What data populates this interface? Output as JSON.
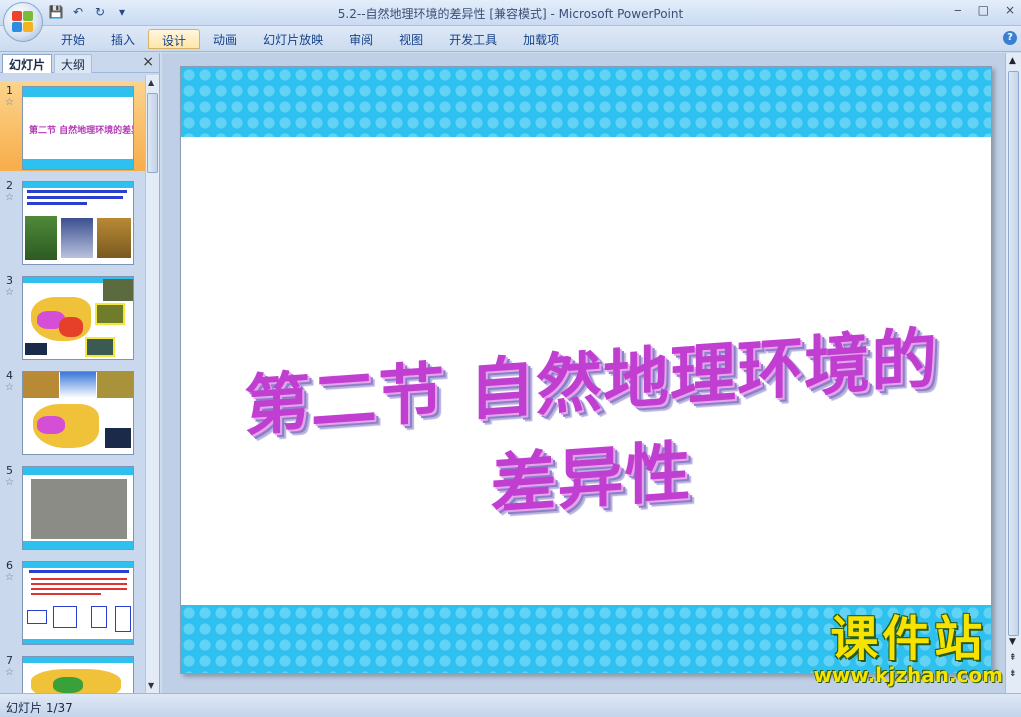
{
  "window": {
    "title": "5.2--自然地理环境的差异性 [兼容模式] - Microsoft PowerPoint",
    "controls": [
      "‒",
      "□",
      "×"
    ]
  },
  "qat": {
    "save": "💾",
    "undo": "↶",
    "redo": "↻",
    "more": "▾"
  },
  "ribbon": {
    "tabs": [
      "开始",
      "插入",
      "设计",
      "动画",
      "幻灯片放映",
      "审阅",
      "视图",
      "开发工具",
      "加载项"
    ],
    "active_tab": "设计",
    "help": "?"
  },
  "left_pane": {
    "tabs": [
      "幻灯片",
      "大纲"
    ],
    "close": "×",
    "thumbnails": [
      {
        "num": "1",
        "star": "☆",
        "title": "第二节 自然地理环境的差异性"
      },
      {
        "num": "2",
        "star": "☆"
      },
      {
        "num": "3",
        "star": "☆"
      },
      {
        "num": "4",
        "star": "☆"
      },
      {
        "num": "5",
        "star": "☆"
      },
      {
        "num": "6",
        "star": "☆"
      },
      {
        "num": "7",
        "star": "☆"
      }
    ]
  },
  "slide": {
    "title": "第二节 自然地理环境的差异性"
  },
  "status": {
    "text": "幻灯片 1/37"
  },
  "watermark": {
    "cn": "课件站",
    "url": "www.kjzhan.com"
  }
}
